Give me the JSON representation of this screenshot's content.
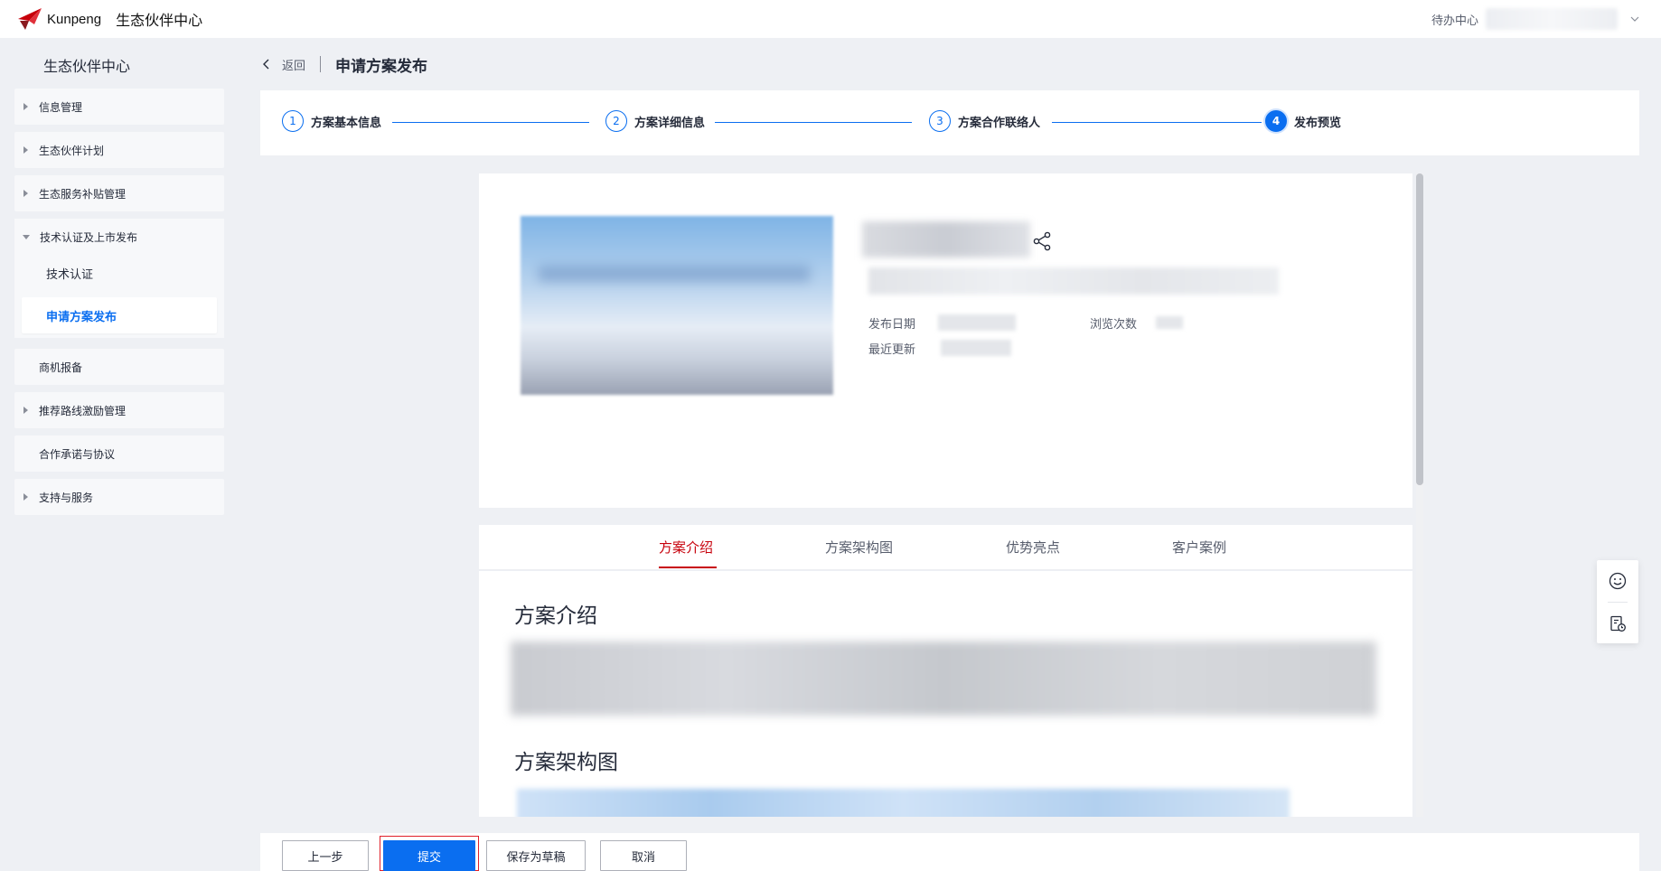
{
  "topbar": {
    "brand": "Kunpeng",
    "title": "生态伙伴中心",
    "todo": "待办中心"
  },
  "sidebar": {
    "title": "生态伙伴中心",
    "items": [
      {
        "label": "信息管理",
        "expandable": true
      },
      {
        "label": "生态伙伴计划",
        "expandable": true
      },
      {
        "label": "生态服务补贴管理",
        "expandable": true
      },
      {
        "label": "技术认证及上市发布",
        "expandable": true,
        "expanded": true
      },
      {
        "label": "商机报备",
        "expandable": false
      },
      {
        "label": "推荐路线激励管理",
        "expandable": true
      },
      {
        "label": "合作承诺与协议",
        "expandable": false
      },
      {
        "label": "支持与服务",
        "expandable": true
      }
    ],
    "subitems": [
      {
        "label": "技术认证",
        "active": false
      },
      {
        "label": "申请方案发布",
        "active": true
      }
    ]
  },
  "header": {
    "back": "返回",
    "title": "申请方案发布"
  },
  "steps": [
    {
      "num": "1",
      "label": "方案基本信息"
    },
    {
      "num": "2",
      "label": "方案详细信息"
    },
    {
      "num": "3",
      "label": "方案合作联络人"
    },
    {
      "num": "4",
      "label": "发布预览",
      "current": true
    }
  ],
  "preview": {
    "meta": {
      "publish_date_label": "发布日期",
      "views_label": "浏览次数",
      "updated_label": "最近更新"
    },
    "tabs": [
      "方案介绍",
      "方案架构图",
      "优势亮点",
      "客户案例"
    ],
    "active_tab": 0,
    "sections": [
      "方案介绍",
      "方案架构图"
    ]
  },
  "actions": {
    "prev": "上一步",
    "submit": "提交",
    "save_draft": "保存为草稿",
    "cancel": "取消"
  },
  "colors": {
    "primary": "#0a6ef0",
    "accent_red": "#c7000b",
    "background": "#eef0f4"
  }
}
